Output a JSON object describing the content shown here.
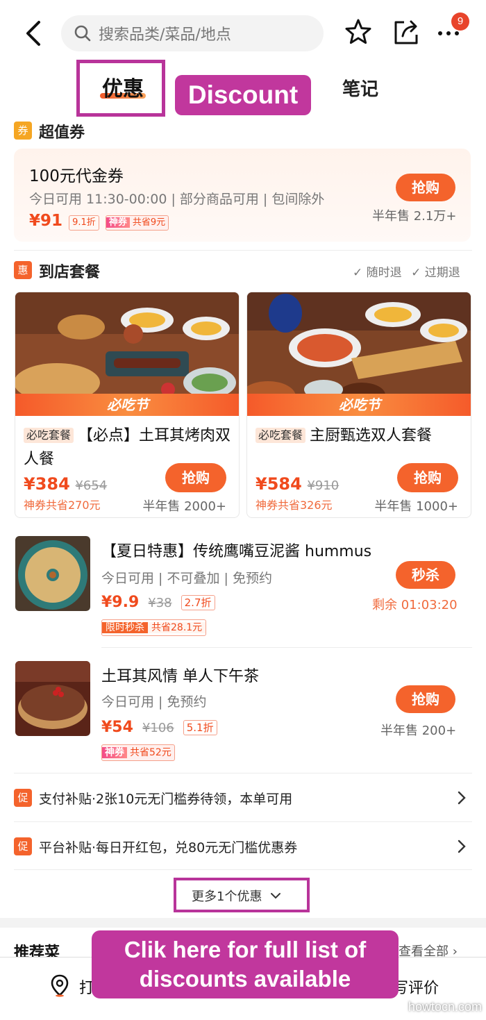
{
  "header": {
    "search_placeholder": "搜索品类/菜品/地点",
    "badge_count": "9"
  },
  "tabs": {
    "active": "优惠",
    "discount_callout": "Discount",
    "notes": "笔记"
  },
  "voucher_section": {
    "icon": "券",
    "title": "超值券",
    "card": {
      "title": "100元代金券",
      "subtitle": "今日可用 11:30-00:00 | 部分商品可用 | 包间除外",
      "price": "¥91",
      "discount": "9.1折",
      "tag_a": "神券",
      "tag_b": "共省9元",
      "button": "抢购",
      "sold": "半年售 2.1万+"
    }
  },
  "package_section": {
    "icon": "惠",
    "title": "到店套餐",
    "refund_any": "随时退",
    "refund_expired": "过期退",
    "cards": [
      {
        "banner": "必吃节",
        "tag": "必吃套餐",
        "title": "【必点】土耳其烤肉双人餐",
        "price": "¥384",
        "original": "¥654",
        "save": "神券共省270元",
        "button": "抢购",
        "sold": "半年售 2000+"
      },
      {
        "banner": "必吃节",
        "tag": "必吃套餐",
        "title": "主厨甄选双人套餐",
        "price": "¥584",
        "original": "¥910",
        "save": "神券共省326元",
        "button": "抢购",
        "sold": "半年售 1000+"
      }
    ]
  },
  "items": [
    {
      "title": "【夏日特惠】传统鹰嘴豆泥酱 hummus",
      "sub": "今日可用 | 不可叠加 | 免预约",
      "price": "¥9.9",
      "original": "¥38",
      "discount": "2.7折",
      "tag_a": "限时秒杀",
      "tag_b": "共省28.1元",
      "button": "秒杀",
      "right_text": "剩余 01:03:20"
    },
    {
      "title": "土耳其风情 单人下午茶",
      "sub": "今日可用 | 免预约",
      "price": "¥54",
      "original": "¥106",
      "discount": "5.1折",
      "tag_a": "神券",
      "tag_b": "共省52元",
      "button": "抢购",
      "right_text": "半年售 200+"
    }
  ],
  "promos": [
    {
      "icon": "促",
      "text": "支付补贴·2张10元无门槛券待领，本单可用"
    },
    {
      "icon": "促",
      "text": "平台补贴·每日开红包，兑80元无门槛优惠券"
    }
  ],
  "more": "更多1个优惠",
  "recommend": {
    "title": "推荐菜",
    "view_all": "查看全部"
  },
  "bottom": {
    "checkin": "打卡",
    "write_review": "写评价"
  },
  "callout_bottom": {
    "line1": "Clik here for full list of",
    "line2": "discounts available"
  },
  "watermark": "howtocn.com",
  "colors": {
    "accent": "#f4632c",
    "callout": "#c1379d",
    "price": "#f04a1d"
  }
}
